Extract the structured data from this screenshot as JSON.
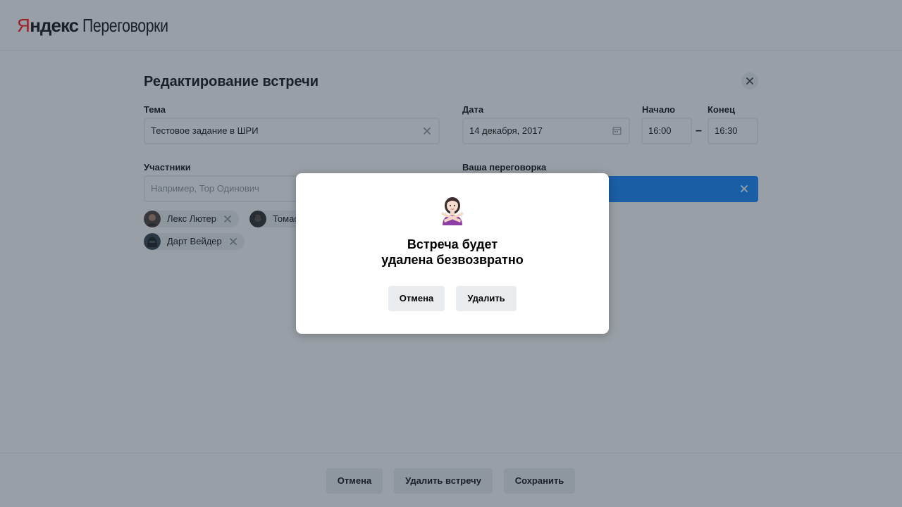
{
  "header": {
    "logo_ya": "Я",
    "logo_brand": "ндекс",
    "logo_product": "Переговорки"
  },
  "form": {
    "title": "Редактирование встречи",
    "topic": {
      "label": "Тема",
      "value": "Тестовое задание в ШРИ"
    },
    "date": {
      "label": "Дата",
      "value": "14 декабря, 2017"
    },
    "start": {
      "label": "Начало",
      "value": "16:00"
    },
    "end": {
      "label": "Конец",
      "value": "16:30"
    },
    "time_separator": "–",
    "participants": {
      "label": "Участники",
      "placeholder": "Например, Тор Одинович",
      "items": [
        {
          "name": "Лекс Лютер"
        },
        {
          "name": "Томас Андерсон"
        },
        {
          "name": "Дарт Вейдер"
        }
      ]
    },
    "room": {
      "label": "Ваша переговорка"
    }
  },
  "footer": {
    "cancel_label": "Отмена",
    "delete_label": "Удалить встречу",
    "save_label": "Сохранить"
  },
  "modal": {
    "emoji": "no-gesture-woman-emoji",
    "title_line1": "Встреча будет",
    "title_line2": "удалена безвозвратно",
    "cancel_label": "Отмена",
    "delete_label": "Удалить"
  },
  "colors": {
    "accent": "#007dff",
    "field_border": "#e9ecef",
    "button_bg": "#e9ecef",
    "overlay": "#333f4d",
    "logo_red": "#ff0000"
  }
}
